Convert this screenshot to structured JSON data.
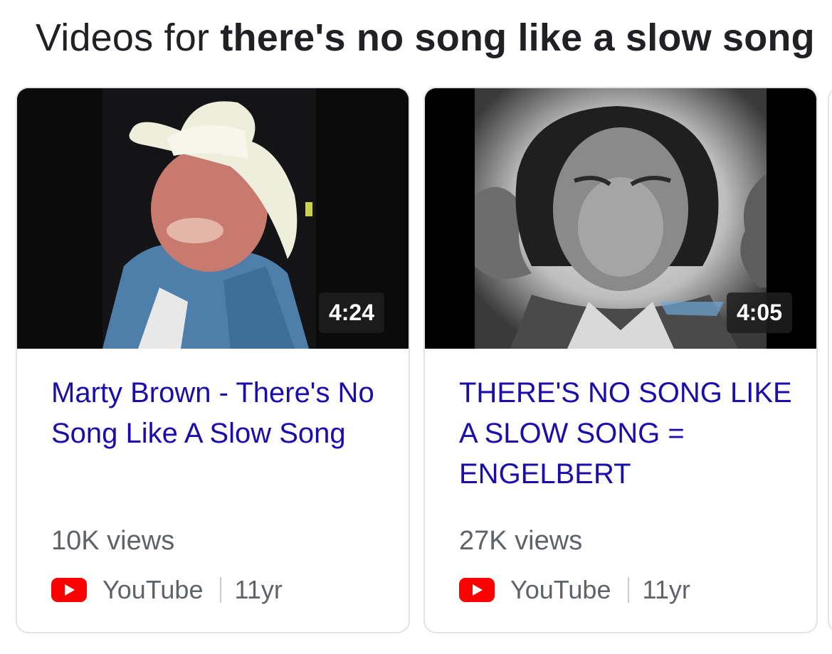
{
  "header": {
    "prefix": "Videos for",
    "query": "there's no song like a slow song"
  },
  "videos": [
    {
      "duration": "4:24",
      "title": "Marty Brown - There's No Song Like A Slow Song",
      "views": "10K views",
      "source": "YouTube",
      "age": "11yr",
      "thumbnail": "man-in-cowboy-hat-photo"
    },
    {
      "duration": "4:05",
      "title": "THERE'S NO SONG LIKE A SLOW SONG = ENGELBERT",
      "views": "27K views",
      "source": "YouTube",
      "age": "11yr",
      "thumbnail": "black-and-white-portrait-photo"
    }
  ],
  "colors": {
    "link": "#1a0dab",
    "meta": "#5f6368",
    "youtube_red": "#ff0000"
  }
}
